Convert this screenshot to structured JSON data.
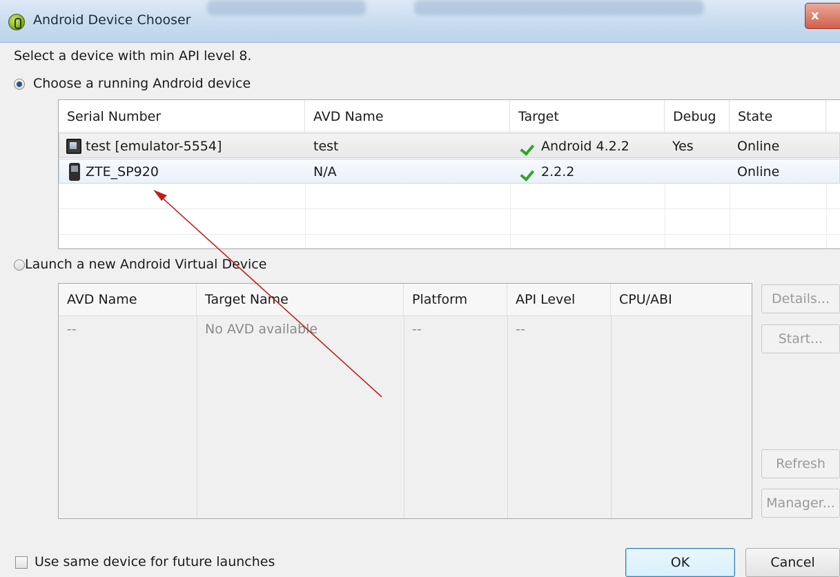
{
  "window": {
    "title": "Android Device Chooser",
    "close_label": "x"
  },
  "prompt": "Select a device with min API level 8.",
  "choose_running": {
    "label": "Choose a running Android device",
    "selected": true
  },
  "devices_table": {
    "columns": [
      "Serial Number",
      "AVD Name",
      "Target",
      "Debug",
      "State"
    ],
    "rows": [
      {
        "serial": "test [emulator-5554]",
        "avd": "test",
        "target": "Android 4.2.2",
        "debug": "Yes",
        "state": "Online",
        "icon": "emulator-icon"
      },
      {
        "serial": "ZTE_SP920",
        "avd": "N/A",
        "target": "2.2.2",
        "debug": "",
        "state": "Online",
        "icon": "phone-icon"
      }
    ]
  },
  "launch_new": {
    "label": "Launch a new Android Virtual Device",
    "selected": false
  },
  "avd_table": {
    "columns": [
      "AVD Name",
      "Target Name",
      "Platform",
      "API Level",
      "CPU/ABI"
    ],
    "rows": [
      {
        "avd": "--",
        "target": "No AVD available",
        "platform": "--",
        "api": "--",
        "cpu": ""
      }
    ]
  },
  "side_buttons": {
    "details": "Details...",
    "start": "Start...",
    "refresh": "Refresh",
    "manager": "Manager..."
  },
  "footer": {
    "same_device_label": "Use same device for future launches",
    "ok": "OK",
    "cancel": "Cancel"
  },
  "colors": {
    "check": "#2fa52a",
    "annotation_arrow": "#c0201a"
  }
}
